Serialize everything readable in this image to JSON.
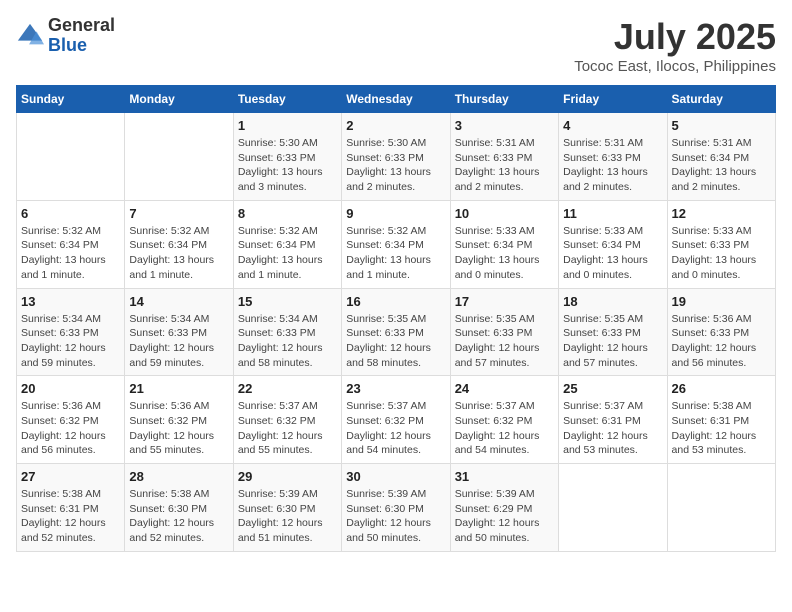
{
  "header": {
    "logo_general": "General",
    "logo_blue": "Blue",
    "title": "July 2025",
    "subtitle": "Tococ East, Ilocos, Philippines"
  },
  "days_of_week": [
    "Sunday",
    "Monday",
    "Tuesday",
    "Wednesday",
    "Thursday",
    "Friday",
    "Saturday"
  ],
  "weeks": [
    [
      {
        "day": "",
        "info": ""
      },
      {
        "day": "",
        "info": ""
      },
      {
        "day": "1",
        "info": "Sunrise: 5:30 AM\nSunset: 6:33 PM\nDaylight: 13 hours and 3 minutes."
      },
      {
        "day": "2",
        "info": "Sunrise: 5:30 AM\nSunset: 6:33 PM\nDaylight: 13 hours and 2 minutes."
      },
      {
        "day": "3",
        "info": "Sunrise: 5:31 AM\nSunset: 6:33 PM\nDaylight: 13 hours and 2 minutes."
      },
      {
        "day": "4",
        "info": "Sunrise: 5:31 AM\nSunset: 6:33 PM\nDaylight: 13 hours and 2 minutes."
      },
      {
        "day": "5",
        "info": "Sunrise: 5:31 AM\nSunset: 6:34 PM\nDaylight: 13 hours and 2 minutes."
      }
    ],
    [
      {
        "day": "6",
        "info": "Sunrise: 5:32 AM\nSunset: 6:34 PM\nDaylight: 13 hours and 1 minute."
      },
      {
        "day": "7",
        "info": "Sunrise: 5:32 AM\nSunset: 6:34 PM\nDaylight: 13 hours and 1 minute."
      },
      {
        "day": "8",
        "info": "Sunrise: 5:32 AM\nSunset: 6:34 PM\nDaylight: 13 hours and 1 minute."
      },
      {
        "day": "9",
        "info": "Sunrise: 5:32 AM\nSunset: 6:34 PM\nDaylight: 13 hours and 1 minute."
      },
      {
        "day": "10",
        "info": "Sunrise: 5:33 AM\nSunset: 6:34 PM\nDaylight: 13 hours and 0 minutes."
      },
      {
        "day": "11",
        "info": "Sunrise: 5:33 AM\nSunset: 6:34 PM\nDaylight: 13 hours and 0 minutes."
      },
      {
        "day": "12",
        "info": "Sunrise: 5:33 AM\nSunset: 6:33 PM\nDaylight: 13 hours and 0 minutes."
      }
    ],
    [
      {
        "day": "13",
        "info": "Sunrise: 5:34 AM\nSunset: 6:33 PM\nDaylight: 12 hours and 59 minutes."
      },
      {
        "day": "14",
        "info": "Sunrise: 5:34 AM\nSunset: 6:33 PM\nDaylight: 12 hours and 59 minutes."
      },
      {
        "day": "15",
        "info": "Sunrise: 5:34 AM\nSunset: 6:33 PM\nDaylight: 12 hours and 58 minutes."
      },
      {
        "day": "16",
        "info": "Sunrise: 5:35 AM\nSunset: 6:33 PM\nDaylight: 12 hours and 58 minutes."
      },
      {
        "day": "17",
        "info": "Sunrise: 5:35 AM\nSunset: 6:33 PM\nDaylight: 12 hours and 57 minutes."
      },
      {
        "day": "18",
        "info": "Sunrise: 5:35 AM\nSunset: 6:33 PM\nDaylight: 12 hours and 57 minutes."
      },
      {
        "day": "19",
        "info": "Sunrise: 5:36 AM\nSunset: 6:33 PM\nDaylight: 12 hours and 56 minutes."
      }
    ],
    [
      {
        "day": "20",
        "info": "Sunrise: 5:36 AM\nSunset: 6:32 PM\nDaylight: 12 hours and 56 minutes."
      },
      {
        "day": "21",
        "info": "Sunrise: 5:36 AM\nSunset: 6:32 PM\nDaylight: 12 hours and 55 minutes."
      },
      {
        "day": "22",
        "info": "Sunrise: 5:37 AM\nSunset: 6:32 PM\nDaylight: 12 hours and 55 minutes."
      },
      {
        "day": "23",
        "info": "Sunrise: 5:37 AM\nSunset: 6:32 PM\nDaylight: 12 hours and 54 minutes."
      },
      {
        "day": "24",
        "info": "Sunrise: 5:37 AM\nSunset: 6:32 PM\nDaylight: 12 hours and 54 minutes."
      },
      {
        "day": "25",
        "info": "Sunrise: 5:37 AM\nSunset: 6:31 PM\nDaylight: 12 hours and 53 minutes."
      },
      {
        "day": "26",
        "info": "Sunrise: 5:38 AM\nSunset: 6:31 PM\nDaylight: 12 hours and 53 minutes."
      }
    ],
    [
      {
        "day": "27",
        "info": "Sunrise: 5:38 AM\nSunset: 6:31 PM\nDaylight: 12 hours and 52 minutes."
      },
      {
        "day": "28",
        "info": "Sunrise: 5:38 AM\nSunset: 6:30 PM\nDaylight: 12 hours and 52 minutes."
      },
      {
        "day": "29",
        "info": "Sunrise: 5:39 AM\nSunset: 6:30 PM\nDaylight: 12 hours and 51 minutes."
      },
      {
        "day": "30",
        "info": "Sunrise: 5:39 AM\nSunset: 6:30 PM\nDaylight: 12 hours and 50 minutes."
      },
      {
        "day": "31",
        "info": "Sunrise: 5:39 AM\nSunset: 6:29 PM\nDaylight: 12 hours and 50 minutes."
      },
      {
        "day": "",
        "info": ""
      },
      {
        "day": "",
        "info": ""
      }
    ]
  ]
}
